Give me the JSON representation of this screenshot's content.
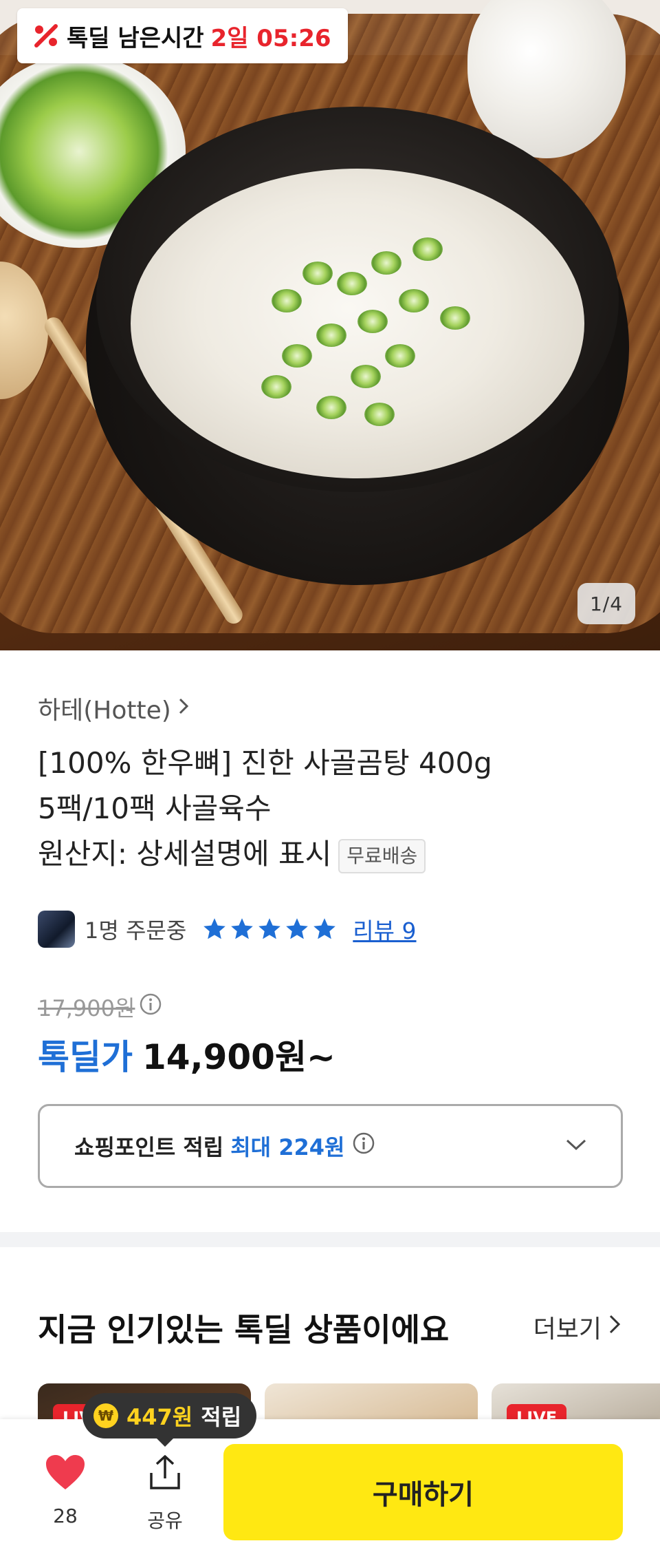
{
  "hero": {
    "deal_badge_label": "톡딜 남은시간",
    "deal_badge_time": "2일 05:26",
    "page_indicator": "1/4"
  },
  "product": {
    "brand": "하테(Hotte)",
    "title_lines": [
      "[100% 한우뼈] 진한 사골곰탕 400g",
      "5팩/10팩 사골육수",
      "원산지: 상세설명에 표시"
    ],
    "free_shipping": "무료배송",
    "ordering": "1명 주문중",
    "rating_stars": 5,
    "review_link": "리뷰 9",
    "original_price": "17,900원",
    "deal_label": "톡딜가",
    "deal_price": "14,900원~"
  },
  "points": {
    "label": "쇼핑포인트 적립",
    "max": "최대 224원"
  },
  "popular": {
    "title": "지금 인기있는 톡딜 상품이에요",
    "more": "더보기",
    "live_tag": "LIVE"
  },
  "bottom": {
    "like_count": "28",
    "share_label": "공유",
    "buy_label": "구매하기",
    "tooltip_icon": "₩",
    "tooltip_amount": "447원",
    "tooltip_suffix": "적립"
  },
  "colors": {
    "accent_blue": "#1f6fd6",
    "deal_red": "#e8242c",
    "buy_yellow": "#ffe812",
    "heart_red": "#ef3b4e"
  },
  "icons": [
    "percent-sale-icon",
    "chevron-right-icon",
    "star-icon",
    "info-icon",
    "chevron-down-icon",
    "heart-icon",
    "share-icon",
    "won-coin-icon"
  ]
}
